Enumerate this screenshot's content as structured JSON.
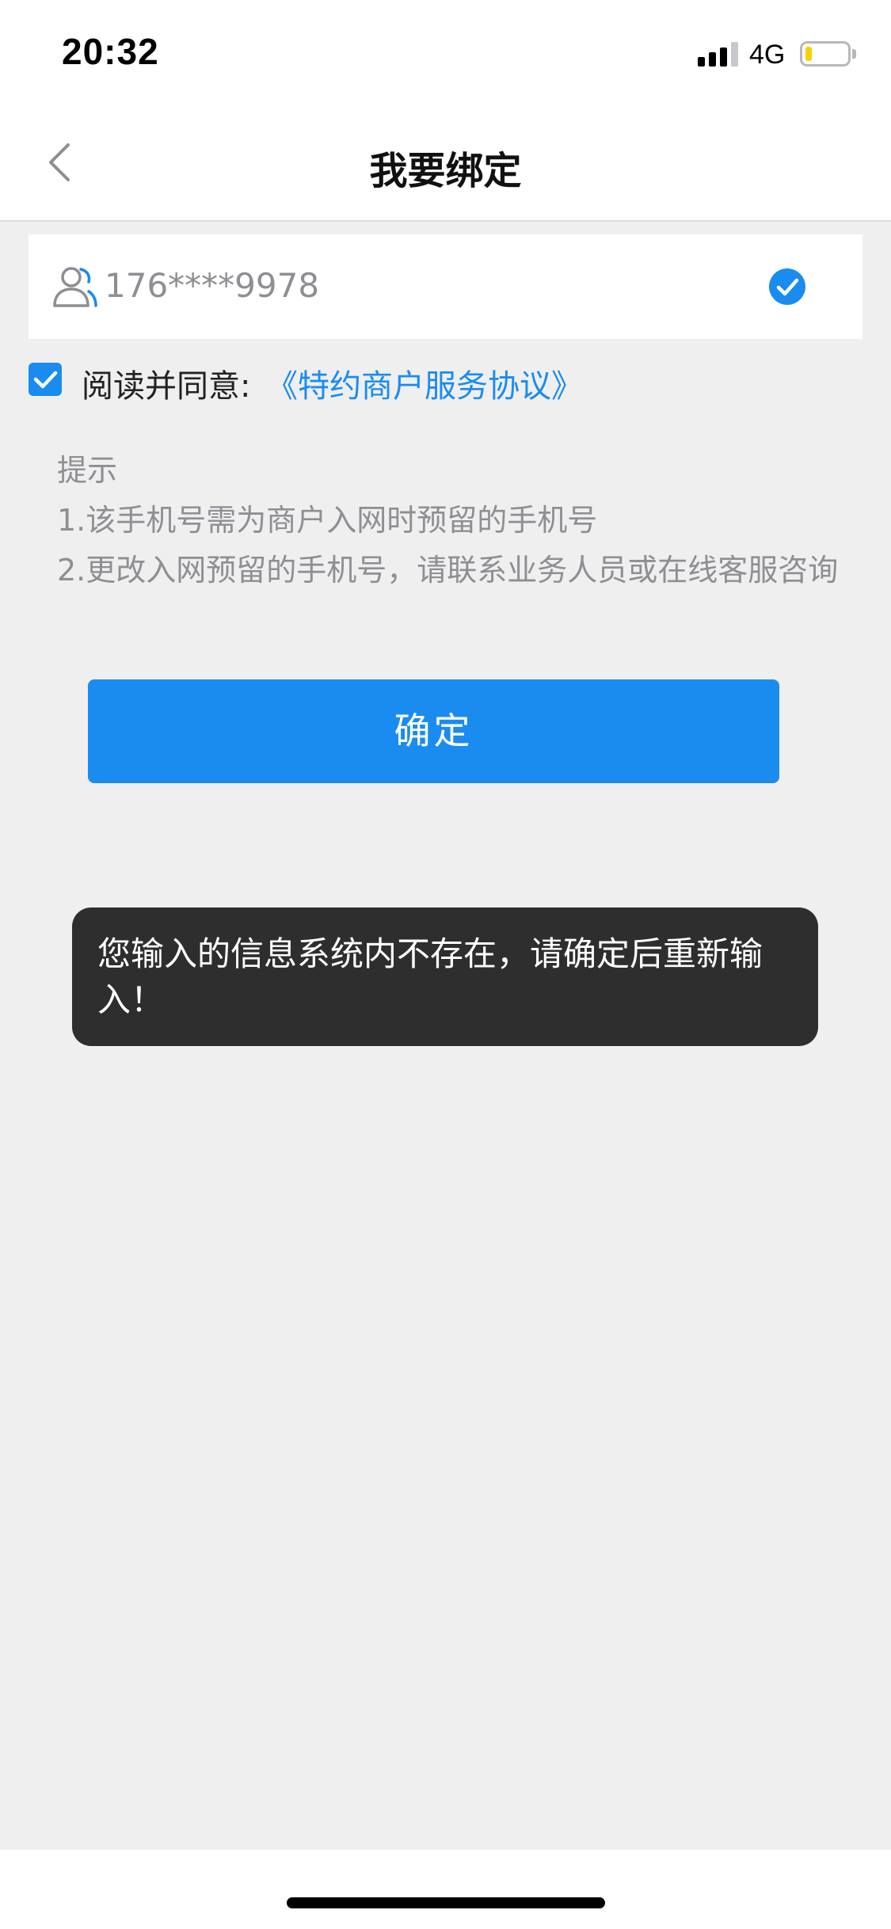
{
  "status_bar": {
    "time": "20:32",
    "network": "4G",
    "battery_level": 0.15,
    "battery_color": "#f5d300"
  },
  "nav": {
    "title": "我要绑定",
    "back_icon": "chevron-left-icon"
  },
  "phone_field": {
    "icon": "user-group-icon",
    "value": "176****9978",
    "verified_icon": "check-circle-icon"
  },
  "agreement": {
    "checked": true,
    "text": "阅读并同意:",
    "link": "《特约商户服务协议》"
  },
  "tips": {
    "title": "提示",
    "line1": "1.该手机号需为商户入网时预留的手机号",
    "line2": "2.更改入网预留的手机号，请联系业务人员或在线客服咨询"
  },
  "confirm_label": "确定",
  "toast_message": "您输入的信息系统内不存在，请确定后重新输入！",
  "colors": {
    "accent": "#1a8cf0",
    "background": "#efeff0",
    "toast_bg": "#2e2e2e"
  }
}
